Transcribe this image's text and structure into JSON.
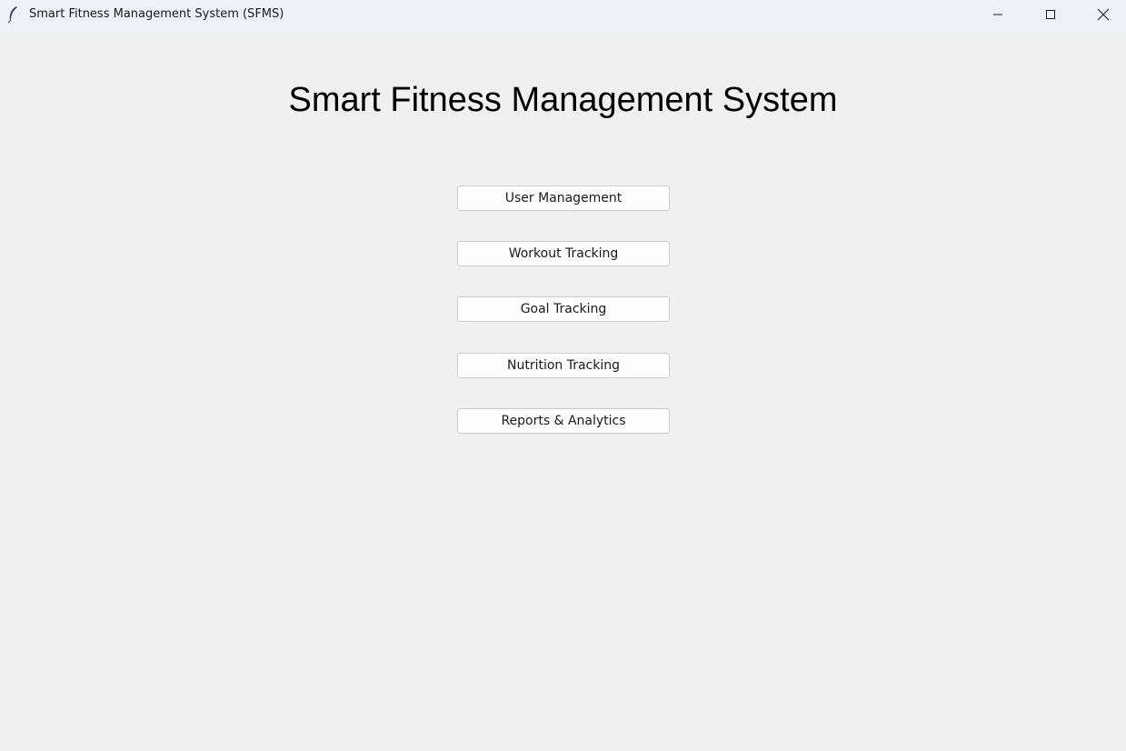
{
  "window": {
    "title": "Smart Fitness Management System (SFMS)",
    "icon": "feather-icon",
    "controls": [
      "minimize-icon",
      "maximize-icon",
      "close-icon"
    ]
  },
  "main": {
    "heading": "Smart Fitness Management System",
    "buttons": [
      {
        "label": "User Management"
      },
      {
        "label": "Workout Tracking"
      },
      {
        "label": "Goal Tracking"
      },
      {
        "label": "Nutrition Tracking"
      },
      {
        "label": "Reports & Analytics"
      }
    ]
  },
  "colors": {
    "background": "#f0f0f0",
    "titlebar": "#eef1f8",
    "button_bg": "#fdfdfd",
    "button_border": "#cdcdcd"
  }
}
